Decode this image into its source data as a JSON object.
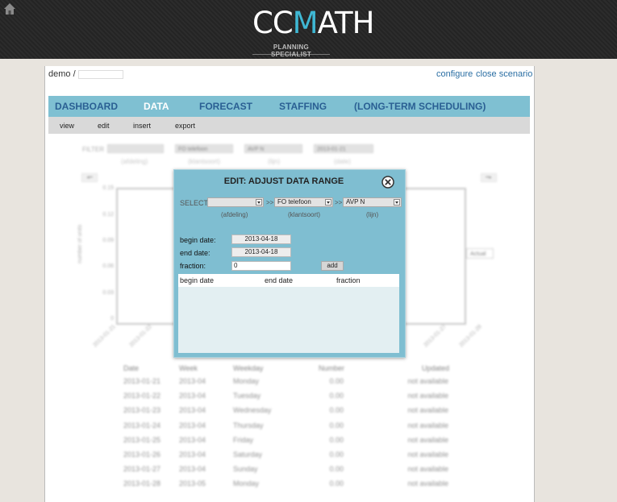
{
  "header": {
    "logo_main_a": "CC",
    "logo_main_b": "M",
    "logo_main_c": "ATH",
    "logo_sub": "PLANNING SPECIALIST"
  },
  "breadcrumb": {
    "user": "demo  /"
  },
  "links": {
    "configure": "configure",
    "close_scenario": "close scenario"
  },
  "main_nav": [
    {
      "label": "DASHBOARD",
      "active": false
    },
    {
      "label": "DATA",
      "active": true
    },
    {
      "label": "FORECAST",
      "active": false
    },
    {
      "label": "STAFFING",
      "active": false
    },
    {
      "label": "(LONG-TERM SCHEDULING)",
      "active": false
    }
  ],
  "sub_nav": [
    "view",
    "edit",
    "insert",
    "export"
  ],
  "background": {
    "filter_label": "FILTER",
    "filter_values": [
      "FO telefoon",
      "AVP N",
      "2013-01-21"
    ],
    "filter_sublabels": [
      "(afdeling)",
      "(klantsoort)",
      "(lijn)",
      "(date)"
    ],
    "chart": {
      "ylabel": "number of units",
      "yticks": [
        "0.15",
        "0.12",
        "0.09",
        "0.06",
        "0.03",
        "0"
      ],
      "xticks": [
        "2013-01-21",
        "2013-01-22",
        "2013-01-27",
        "2013-01-28"
      ],
      "legend": "Actual"
    },
    "table": {
      "columns": [
        "Date",
        "Week",
        "Weekday",
        "Number",
        "Updated"
      ],
      "rows": [
        [
          "2013-01-21",
          "2013-04",
          "Monday",
          "0.00",
          "not available"
        ],
        [
          "2013-01-22",
          "2013-04",
          "Tuesday",
          "0.00",
          "not available"
        ],
        [
          "2013-01-23",
          "2013-04",
          "Wednesday",
          "0.00",
          "not available"
        ],
        [
          "2013-01-24",
          "2013-04",
          "Thursday",
          "0.00",
          "not available"
        ],
        [
          "2013-01-25",
          "2013-04",
          "Friday",
          "0.00",
          "not available"
        ],
        [
          "2013-01-26",
          "2013-04",
          "Saturday",
          "0.00",
          "not available"
        ],
        [
          "2013-01-27",
          "2013-04",
          "Sunday",
          "0.00",
          "not available"
        ],
        [
          "2013-01-28",
          "2013-05",
          "Monday",
          "0.00",
          "not available"
        ]
      ]
    }
  },
  "modal": {
    "title": "EDIT: ADJUST DATA RANGE",
    "select_label": "SELECT",
    "separator": ">>",
    "selects": [
      {
        "value": "",
        "sublabel": "(afdeling)"
      },
      {
        "value": "FO telefoon",
        "sublabel": "(klantsoort)"
      },
      {
        "value": "AVP N",
        "sublabel": "(lijn)"
      }
    ],
    "begin_date_label": "begin date:",
    "begin_date_value": "2013-04-18",
    "end_date_label": "end date:",
    "end_date_value": "2013-04-18",
    "fraction_label": "fraction:",
    "fraction_value": "0",
    "add_label": "add",
    "list_columns": [
      "begin date",
      "end date",
      "fraction"
    ]
  }
}
